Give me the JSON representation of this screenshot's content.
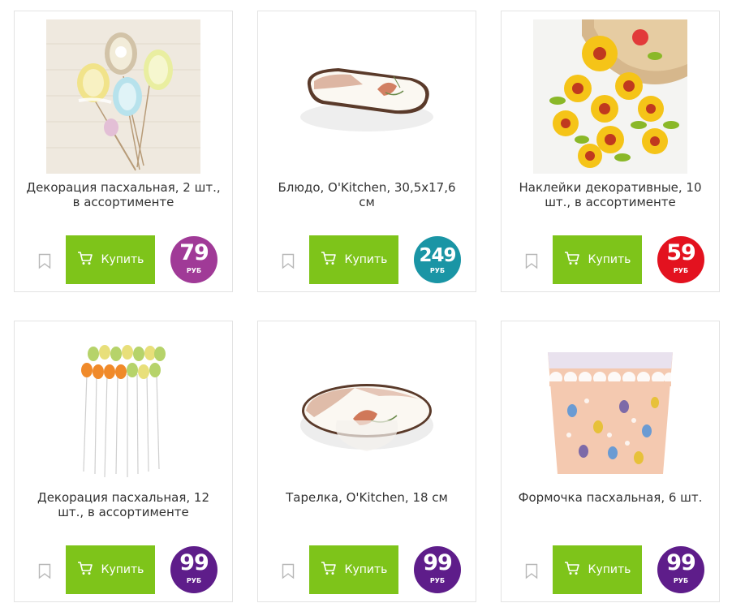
{
  "buy_label": "Купить",
  "currency": "РУБ",
  "products": [
    {
      "title": "Декорация пасхальная, 2 шт., в ассортименте",
      "price": "79",
      "price_color": "#a03a97",
      "image": "easter-egg-decor-image"
    },
    {
      "title": "Блюдо, O'Kitchen, 30,5x17,6 см",
      "price": "249",
      "price_color": "#1a95a5",
      "image": "oval-platter-image"
    },
    {
      "title": "Наклейки декоративные, 10 шт., в ассортименте",
      "price": "59",
      "price_color": "#e3121f",
      "image": "sunflower-stickers-image"
    },
    {
      "title": "Декорация пасхальная, 12 шт., в ассортименте",
      "price": "99",
      "price_color": "#5e1d8a",
      "image": "egg-picks-image"
    },
    {
      "title": "Тарелка, O'Kitchen, 18 см",
      "price": "99",
      "price_color": "#5e1d8a",
      "image": "round-plate-image"
    },
    {
      "title": "Формочка пасхальная, 6 шт.",
      "price": "99",
      "price_color": "#5e1d8a",
      "image": "baking-cups-image"
    }
  ],
  "colors": {
    "buy_button": "#7ec41a",
    "border": "#e3e3e3"
  }
}
